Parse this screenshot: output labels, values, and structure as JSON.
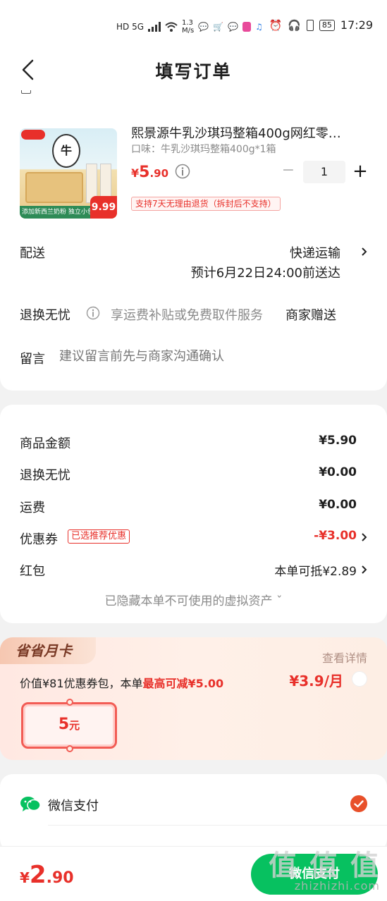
{
  "status_bar": {
    "network": "HD 5G",
    "speed_value": "1.3",
    "speed_unit": "M/s",
    "battery": "85",
    "time": "17:29"
  },
  "header": {
    "title": "填写订单",
    "back_icon": "chevron-left-icon"
  },
  "product": {
    "title": "熙景源牛乳沙琪玛整箱400g网红零…",
    "spec": "口味：牛乳沙琪玛整箱400g*1箱",
    "price_currency": "¥",
    "price_int": "5",
    "price_dec": ".90",
    "quantity": "1",
    "return_policy": "支持7天无理由退货（拆封后不支持）",
    "image_badge_price": "9.99",
    "image_caption": "添加新西兰奶粉 独立小包装"
  },
  "delivery": {
    "label": "配送",
    "method": "快递运输",
    "eta": "预计6月22日24:00前送达"
  },
  "exchange": {
    "label": "退换无忧",
    "text": "享运费补贴或免费取件服务",
    "gift": "商家赠送"
  },
  "note": {
    "label": "留言",
    "placeholder": "建议留言前先与商家沟通确认"
  },
  "summary": {
    "rows": [
      {
        "label": "商品金额",
        "value": "¥5.90"
      },
      {
        "label": "退换无忧",
        "value": "¥0.00"
      },
      {
        "label": "运费",
        "value": "¥0.00"
      },
      {
        "label": "优惠券",
        "tag": "已选推荐优惠",
        "value": "-¥3.00"
      },
      {
        "label": "红包",
        "value": "本单可抵¥2.89"
      }
    ],
    "hidden_assets": "已隐藏本单不可使用的虚拟资产 ˇ"
  },
  "monthly_card": {
    "badge": "省省月卡",
    "view_details": "查看详情",
    "desc_prefix": "价值¥81优惠券包，本单",
    "desc_highlight": "最高可减¥5.00",
    "price": "¥3.9/月",
    "coupon_amount": "5",
    "coupon_unit": "元"
  },
  "payment": {
    "method_label": "微信支付",
    "icon": "wechat-icon"
  },
  "bottom": {
    "total_currency": "¥",
    "total_int": "2",
    "total_dec": ".90",
    "pay_button": "微信支付"
  },
  "watermark": {
    "big": "值 值 值",
    "small": "zhizhizhi.com"
  },
  "colors": {
    "accent_red": "#e8302a",
    "wechat_green": "#07c160"
  }
}
